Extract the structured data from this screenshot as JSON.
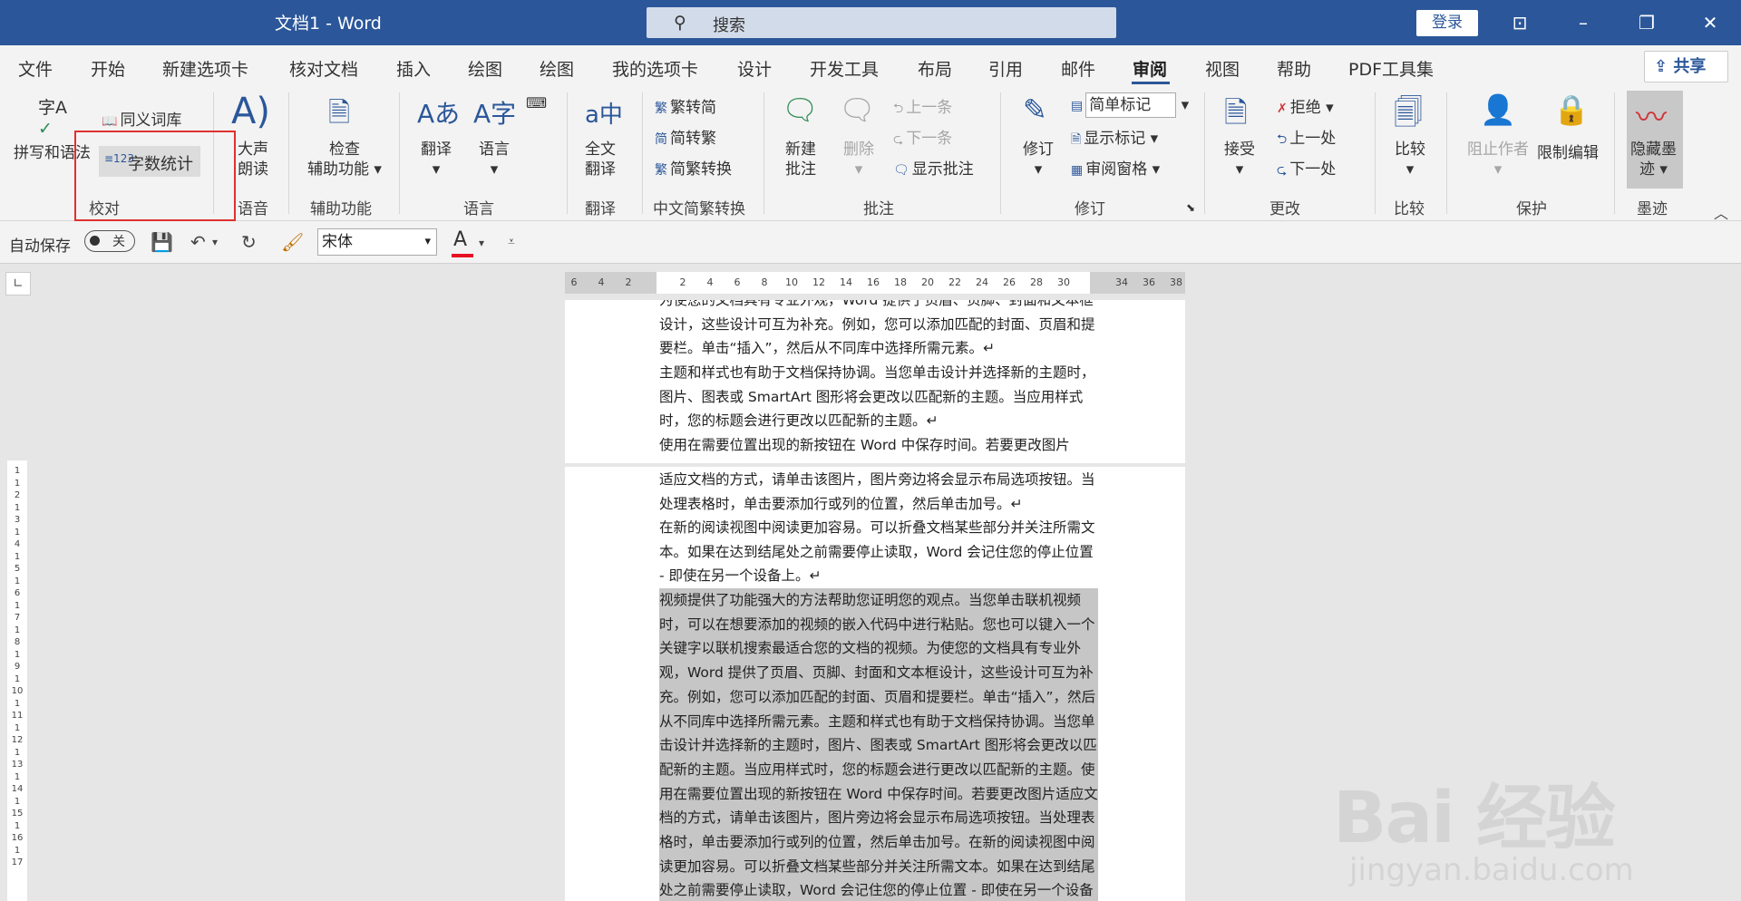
{
  "titlebar": {
    "doc_title": "文档1  -  Word",
    "search_placeholder": "搜索",
    "login_label": "登录"
  },
  "tabs": [
    "文件",
    "开始",
    "新建选项卡",
    "核对文档",
    "插入",
    "绘图",
    "绘图",
    "我的选项卡",
    "设计",
    "开发工具",
    "布局",
    "引用",
    "邮件",
    "审阅",
    "视图",
    "帮助",
    "PDF工具集"
  ],
  "share_label": "共享",
  "ribbon": {
    "proofing": {
      "spell": "拼写和语法",
      "thesaurus": "同义词库",
      "wordcount": "字数统计",
      "group": "校对"
    },
    "speech": {
      "read_aloud_1": "大声",
      "read_aloud_2": "朗读",
      "group": "语音"
    },
    "accessibility": {
      "check_1": "检查",
      "check_2": "辅助功能",
      "group": "辅助功能"
    },
    "language": {
      "translate": "翻译",
      "language": "语言",
      "group": "语言"
    },
    "translate": {
      "full_1": "全文",
      "full_2": "翻译",
      "group": "翻译"
    },
    "chinese": {
      "to_simp": "繁转简",
      "to_trad": "简转繁",
      "convert": "简繁转换",
      "group": "中文简繁转换"
    },
    "comments": {
      "new_1": "新建",
      "new_2": "批注",
      "delete": "删除",
      "prev": "上一条",
      "next": "下一条",
      "show": "显示批注",
      "group": "批注"
    },
    "tracking": {
      "track": "修订",
      "markup_select": "简单标记",
      "show_markup": "显示标记",
      "review_pane": "审阅窗格",
      "group": "修订"
    },
    "changes": {
      "accept": "接受",
      "reject": "拒绝",
      "prev": "上一处",
      "next": "下一处",
      "group": "更改"
    },
    "compare": {
      "compare": "比较",
      "group": "比较"
    },
    "protect": {
      "block": "阻止作者",
      "restrict": "限制编辑",
      "group": "保护"
    },
    "ink": {
      "hide_1": "隐藏墨",
      "hide_2": "迹",
      "group": "墨迹"
    }
  },
  "qat": {
    "autosave": "自动保存",
    "autosave_state": "关",
    "font": "宋体",
    "font_color_letter": "A"
  },
  "ruler": {
    "h_ticks": [
      "6",
      "4",
      "2",
      "2",
      "4",
      "6",
      "8",
      "10",
      "12",
      "14",
      "16",
      "18",
      "20",
      "22",
      "24",
      "26",
      "28",
      "30",
      "34",
      "36",
      "38"
    ],
    "v_ticks": [
      "1",
      "1",
      "2",
      "1",
      "3",
      "1",
      "4",
      "1",
      "5",
      "1",
      "6",
      "1",
      "7",
      "1",
      "8",
      "1",
      "9",
      "1",
      "10",
      "1",
      "11",
      "1",
      "12",
      "1",
      "13",
      "1",
      "14",
      "1",
      "15",
      "1",
      "16",
      "1",
      "17"
    ]
  },
  "page1": [
    "为使您的文档具有专业外观，Word 提供了页眉、页脚、封面和文本框设计，这些设计可互为补充。例如，您可以添加匹配的封面、页眉和提要栏。单击“插入”，然后从不同库中选择所需元素。↵",
    "主题和样式也有助于文档保持协调。当您单击设计并选择新的主题时，图片、图表或 SmartArt 图形将会更改以匹配新的主题。当应用样式时，您的标题会进行更改以匹配新的主题。↵",
    "使用在需要位置出现的新按钮在 Word 中保存时间。若要更改图片"
  ],
  "page2": [
    "适应文档的方式，请单击该图片，图片旁边将会显示布局选项按钮。当处理表格时，单击要添加行或列的位置，然后单击加号。↵",
    "在新的阅读视图中阅读更加容易。可以折叠文档某些部分并关注所需文本。如果在达到结尾处之前需要停止读取，Word 会记住您的停止位置 - 即使在另一个设备上。↵",
    "视频提供了功能强大的方法帮助您证明您的观点。当您单击联机视频时，可以在想要添加的视频的嵌入代码中进行粘贴。您也可以键入一个关键字以联机搜索最适合您的文档的视频。为使您的文档具有专业外观，Word 提供了页眉、页脚、封面和文本框设计，这些设计可互为补充。例如，您可以添加匹配的封面、页眉和提要栏。单击“插入”，然后从不同库中选择所需元素。主题和样式也有助于文档保持协调。当您单击设计并选择新的主题时，图片、图表或 SmartArt 图形将会更改以匹配新的主题。当应用样式时，您的标题会进行更改以匹配新的主题。使用在需要位置出现的新按钮在 Word 中保存时间。若要更改图片适应文档的方式，请单击该图片，图片旁边将会显示布局选项按钮。当处理表格时，单击要添加行或列的位置，然后单击加号。在新的阅读视图中阅读更加容易。可以折叠文档某些部分并关注所需文本。如果在达到结尾处之前需要停止读取，Word 会记住您的停止位置 - 即使在另一个设备上。视频提供了功能强大的方法帮助"
  ],
  "watermark": {
    "logo": "Bai 经验",
    "url": "jingyan.baidu.com"
  }
}
